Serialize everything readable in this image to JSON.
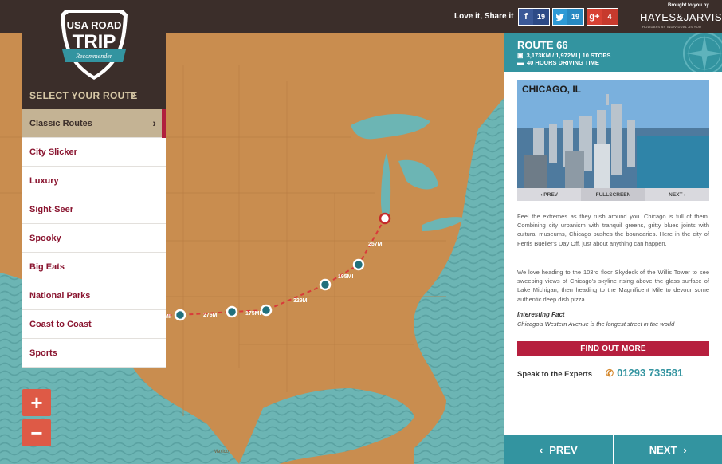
{
  "header": {
    "share_label": "Love it, Share it",
    "facebook_count": "19",
    "twitter_count": "19",
    "gplus_count": "4",
    "brand_small": "Brought to you by",
    "brand": "HAYES&JARVIS",
    "brand_tag": "HOLIDAYS AS INDIVIDUAL AS YOU"
  },
  "logo": {
    "line1": "USA ROAD",
    "line2": "TRIP",
    "line3": "Recommender"
  },
  "sidebar": {
    "select_label": "SELECT YOUR ROUTE",
    "items": [
      {
        "label": "Classic Routes",
        "active": true
      },
      {
        "label": "City Slicker"
      },
      {
        "label": "Luxury"
      },
      {
        "label": "Sight-Seer"
      },
      {
        "label": "Spooky"
      },
      {
        "label": "Big Eats"
      },
      {
        "label": "National Parks"
      },
      {
        "label": "Coast to Coast"
      },
      {
        "label": "Sports"
      }
    ]
  },
  "zoom": {
    "in": "+",
    "out": "−"
  },
  "map": {
    "distances": [
      "257MI",
      "195MI",
      "329MI",
      "175MI",
      "276MI",
      "MI"
    ],
    "bottom_label": "Mexico"
  },
  "route": {
    "title": "ROUTE 66",
    "meta1": "3,173KM / 1,972MI | 10 STOPS",
    "meta2": "40 HOURS DRIVING TIME",
    "stop_title": "CHICAGO, IL",
    "photo_prev": "PREV",
    "photo_fullscreen": "FULLSCREEN",
    "photo_next": "NEXT",
    "para1": "Feel the extremes as they rush around you. Chicago is full of them. Combining city urbanism with tranquil greens, gritty blues joints with cultural museums, Chicago pushes the boundaries. Here in the city of Ferris Bueller's Day Off, just about anything can happen.",
    "para2": "We love heading to the 103rd floor Skydeck of the Willis Tower to see sweeping views of Chicago's skyline rising above the glass surface of Lake Michigan, then heading to the Magnificent Mile to devour some authentic deep dish pizza.",
    "fact_title": "Interesting Fact",
    "fact": "Chicago's Western Avenue is the longest street in the world",
    "find_out": "FIND OUT MORE",
    "speak": "Speak to the Experts",
    "phone": "01293 733581",
    "prev": "PREV",
    "next": "NEXT"
  },
  "colors": {
    "teal": "#3394a0",
    "crimson": "#b61f3e",
    "dark": "#3b2e2a",
    "map": "#c98d4f"
  }
}
